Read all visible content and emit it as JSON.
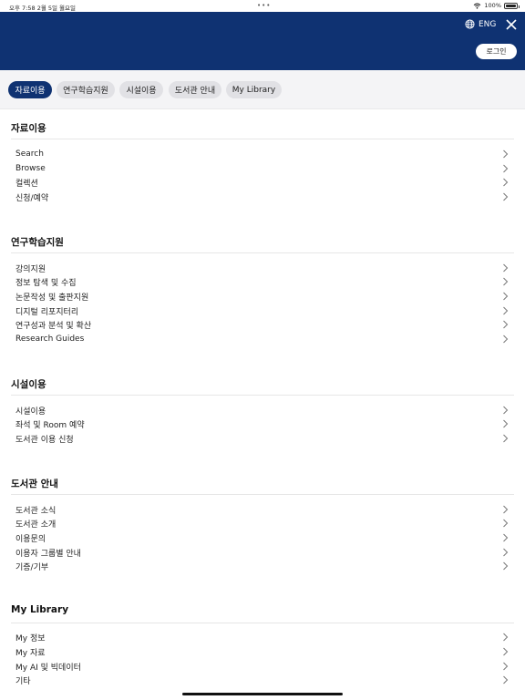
{
  "status_bar": {
    "time": "오후 7:58   2월 5일 월요일",
    "battery": "100%"
  },
  "header": {
    "lang_label": "ENG",
    "login_label": "로그인"
  },
  "tabs": [
    {
      "label": "자료이용",
      "active": true
    },
    {
      "label": "연구학습지원",
      "active": false
    },
    {
      "label": "시설이용",
      "active": false
    },
    {
      "label": "도서관 안내",
      "active": false
    },
    {
      "label": "My Library",
      "active": false
    }
  ],
  "sections": [
    {
      "title": "자료이용",
      "items": [
        "Search",
        "Browse",
        "컬렉션",
        "신청/예약"
      ]
    },
    {
      "title": "연구학습지원",
      "items": [
        "강의지원",
        "정보 탐색 및 수집",
        "논문작성 및 출판지원",
        "디지털 리포지터리",
        "연구성과 분석 및 확산",
        "Research Guides"
      ]
    },
    {
      "title": "시설이용",
      "items": [
        "시설이용",
        "좌석 및 Room 예약",
        "도서관 이용 신청"
      ]
    },
    {
      "title": "도서관 안내",
      "items": [
        "도서관 소식",
        "도서관 소개",
        "이용문의",
        "이용자 그룹별 안내",
        "기증/기부"
      ]
    },
    {
      "title": "My Library",
      "items": [
        "My 정보",
        "My 자료",
        "My AI 및 빅데이터",
        "기타"
      ]
    }
  ],
  "colors": {
    "brand_navy": "#0f3272",
    "tab_bg": "#e1e1e5",
    "tabbar_bg": "#f4f4f6"
  }
}
